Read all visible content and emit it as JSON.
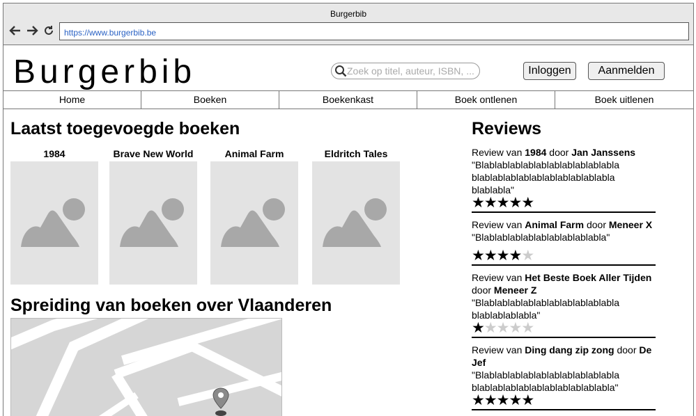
{
  "browser": {
    "title": "Burgerbib",
    "url": "https://www.burgerbib.be"
  },
  "header": {
    "logo": "Burgerbib",
    "search_placeholder": "Zoek op titel, auteur, ISBN, ...",
    "login_label": "Inloggen",
    "signup_label": "Aanmelden"
  },
  "menu": [
    "Home",
    "Boeken",
    "Boekenkast",
    "Boek ontlenen",
    "Boek uitlenen"
  ],
  "latest": {
    "heading": "Laatst toegevoegde boeken",
    "books": [
      "1984",
      "Brave New World",
      "Animal Farm",
      "Eldritch Tales"
    ]
  },
  "spread": {
    "heading": "Spreiding van boeken over Vlaanderen"
  },
  "reviews": {
    "heading": "Reviews",
    "items": [
      {
        "prefix": "Review van ",
        "book": "1984",
        "mid": " door ",
        "author": "Jan Janssens",
        "text": "\"Blablablablablablablablablablabla blablablablablablablablablablabla blablabla\"",
        "rating": 5
      },
      {
        "prefix": "Review van ",
        "book": "Animal Farm",
        "mid": " door ",
        "author": "Meneer X",
        "text": "\"Blablablablablablablablablabla\"",
        "rating": 4
      },
      {
        "prefix": "Review van ",
        "book": "Het Beste Boek Aller Tijden",
        "mid": " door ",
        "author": "Meneer Z",
        "text": "\"Blablablablablablablablablablabla blablablablabla\"",
        "rating": 1
      },
      {
        "prefix": "Review van ",
        "book": "Ding dang zip zong",
        "mid": " door ",
        "author": "De Jef",
        "text": "\"Blablablablablablablablablablabla blablablablablablablablablablabla\"",
        "rating": 5
      }
    ]
  },
  "icons": {
    "back": "arrow-left-icon",
    "forward": "arrow-right-icon",
    "reload": "reload-icon",
    "search": "search-icon",
    "image": "image-placeholder-icon",
    "pin": "map-pin-icon",
    "star": "star-icon"
  }
}
